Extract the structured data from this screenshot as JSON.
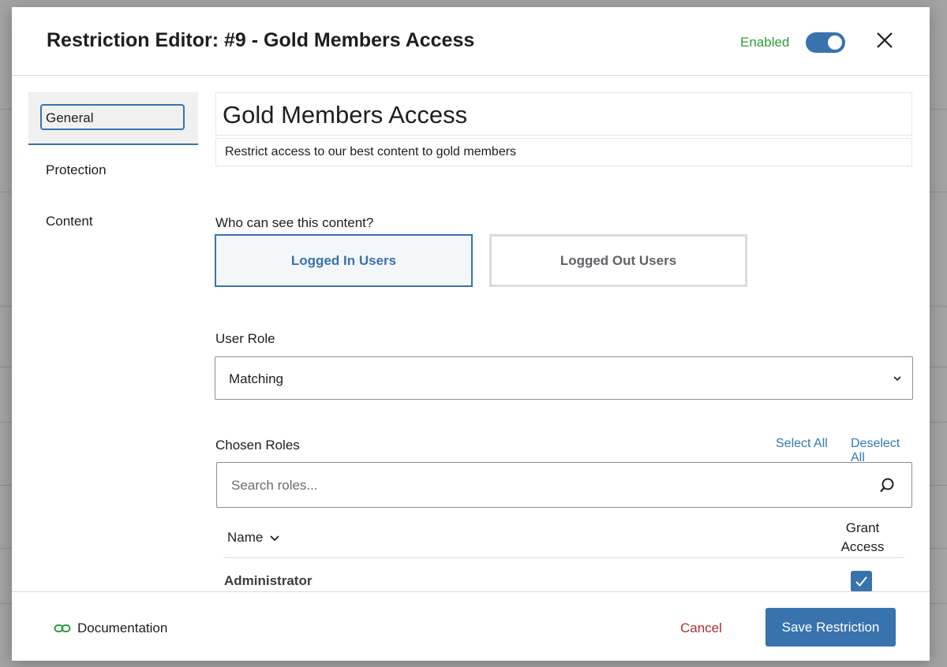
{
  "modal": {
    "title": "Restriction Editor: #9 - Gold Members Access",
    "status_label": "Enabled",
    "enabled": true
  },
  "sidebar": {
    "items": [
      {
        "label": "General",
        "active": true
      },
      {
        "label": "Protection",
        "active": false
      },
      {
        "label": "Content",
        "active": false
      }
    ]
  },
  "general": {
    "restriction_title": "Gold Members Access",
    "description": "Restrict access to our best content to gold members",
    "who_label": "Who can see this content?",
    "options": [
      {
        "label": "Logged In Users",
        "selected": true
      },
      {
        "label": "Logged Out Users",
        "selected": false
      }
    ],
    "user_role_label": "User Role",
    "user_role_value": "Matching",
    "chosen_roles_label": "Chosen Roles",
    "select_all": "Select All",
    "deselect_all": "Deselect All",
    "search_placeholder": "Search roles...",
    "table": {
      "col_name": "Name",
      "col_grant_line1": "Grant",
      "col_grant_line2": "Access",
      "rows": [
        {
          "name": "Administrator",
          "granted": true
        }
      ]
    }
  },
  "footer": {
    "documentation": "Documentation",
    "cancel": "Cancel",
    "save": "Save Restriction"
  },
  "colors": {
    "accent": "#3873ad",
    "enabled": "#2e9c3b",
    "cancel": "#b32d2e",
    "link": "#2f7ab4"
  }
}
